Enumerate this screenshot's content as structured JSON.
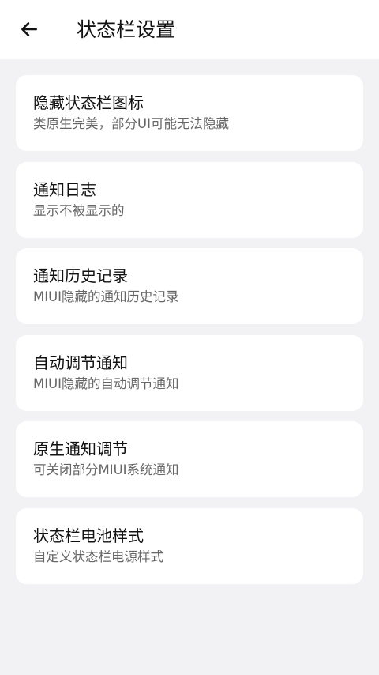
{
  "header": {
    "back_icon": "arrow-left-icon",
    "title": "状态栏设置"
  },
  "settings": {
    "items": [
      {
        "title": "隐藏状态栏图标",
        "subtitle": "类原生完美，部分UI可能无法隐藏"
      },
      {
        "title": "通知日志",
        "subtitle": "显示不被显示的"
      },
      {
        "title": "通知历史记录",
        "subtitle": "MIUI隐藏的通知历史记录"
      },
      {
        "title": "自动调节通知",
        "subtitle": "MIUI隐藏的自动调节通知"
      },
      {
        "title": "原生通知调节",
        "subtitle": "可关闭部分MIUI系统通知"
      },
      {
        "title": "状态栏电池样式",
        "subtitle": "自定义状态栏电源样式"
      }
    ]
  }
}
